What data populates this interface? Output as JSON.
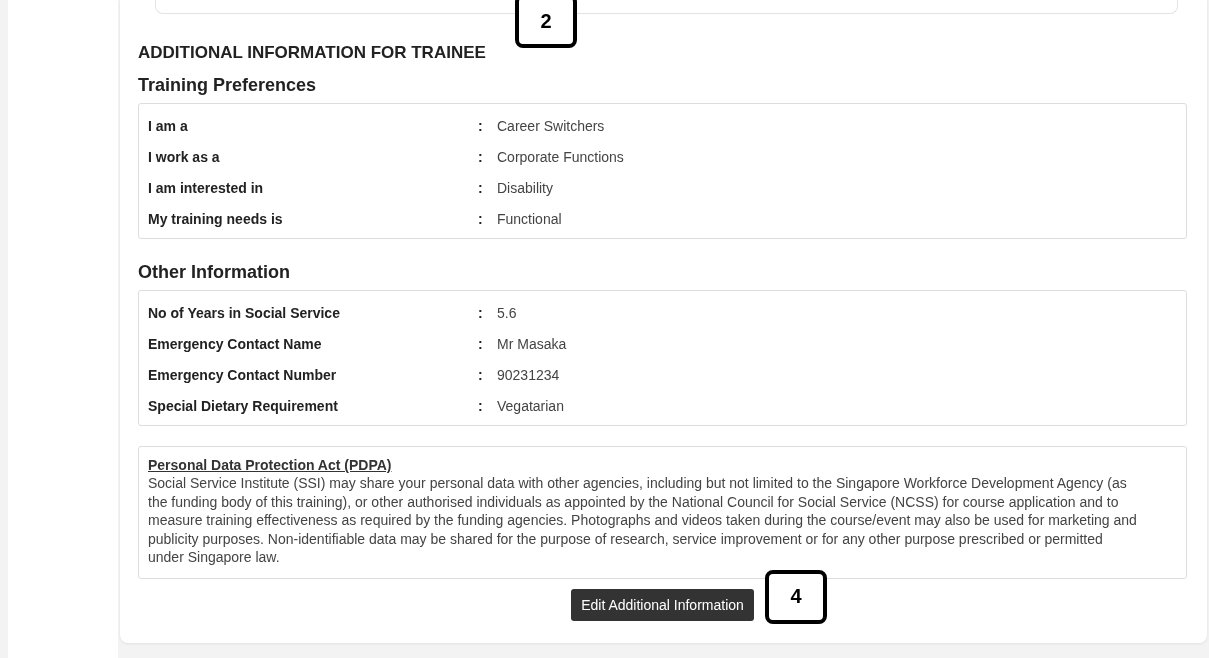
{
  "heading": {
    "text": "ADDITIONAL INFORMATION FOR TRAINEE",
    "callout": "2"
  },
  "sections": [
    {
      "title": "Training Preferences",
      "rows": [
        {
          "label": "I am a",
          "separator": ":",
          "value": "Career Switchers"
        },
        {
          "label": "I work as a",
          "separator": ":",
          "value": "Corporate Functions"
        },
        {
          "label": "I am interested in",
          "separator": ":",
          "value": "Disability"
        },
        {
          "label": "My training needs is",
          "separator": ":",
          "value": "Functional"
        }
      ]
    },
    {
      "title": "Other Information",
      "rows": [
        {
          "label": "No of Years in Social Service",
          "separator": ":",
          "value": "5.6"
        },
        {
          "label": "Emergency Contact Name",
          "separator": ":",
          "value": "Mr Masaka"
        },
        {
          "label": "Emergency Contact Number",
          "separator": ":",
          "value": "90231234"
        },
        {
          "label": "Special Dietary Requirement",
          "separator": ":",
          "value": "Vegatarian"
        }
      ]
    }
  ],
  "pdpa": {
    "title": "Personal Data Protection Act (PDPA)",
    "text": "Social Service Institute (SSI) may share your personal data with other agencies, including but not limited to the Singapore Workforce Development Agency (as the funding body of this training), or other authorised individuals as appointed by the National Council for Social Service (NCSS) for course application and to measure training effectiveness as required by the funding agencies. Photographs and videos taken during the course/event may also be used for marketing and publicity purposes. Non-identifiable data may be shared for the purpose of research, service improvement or for any other purpose prescribed or permitted under Singapore law."
  },
  "button": {
    "label": "Edit Additional Information",
    "callout": "4"
  }
}
